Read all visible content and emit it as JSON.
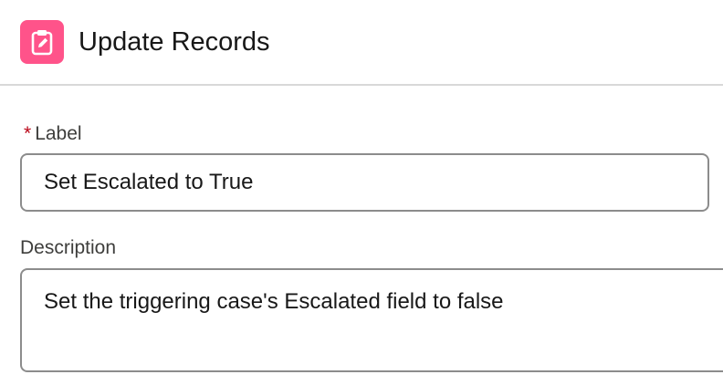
{
  "header": {
    "title": "Update Records",
    "icon": "clipboard-edit-icon",
    "icon_color": "#ff538a"
  },
  "form": {
    "label_field": {
      "required_marker": "*",
      "label": "Label",
      "value": "Set Escalated to True"
    },
    "description_field": {
      "label": "Description",
      "value": "Set the triggering case's Escalated field to false"
    }
  }
}
